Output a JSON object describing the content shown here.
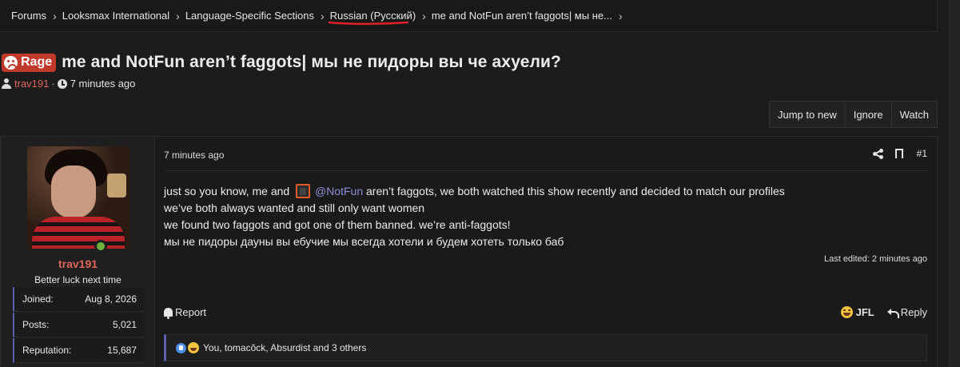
{
  "breadcrumb": [
    {
      "label": "Forums"
    },
    {
      "label": "Looksmax International"
    },
    {
      "label": "Language-Specific Sections"
    },
    {
      "label": "Russian (Русский)"
    },
    {
      "label": "me and NotFun aren’t faggots| мы не..."
    }
  ],
  "thread": {
    "prefix": "Rage",
    "title": "me and NotFun aren’t faggots| мы не пидоры вы че ахуели?",
    "author": "trav191",
    "separator": "·",
    "time": "7 minutes ago"
  },
  "thread_actions": {
    "jump_label": "Jump to new",
    "ignore_label": "Ignore",
    "watch_label": "Watch"
  },
  "post": {
    "time": "7 minutes ago",
    "number": "#1",
    "user": {
      "name": "trav191",
      "title": "Better luck next time",
      "stats": [
        {
          "key": "Joined:",
          "value": "Aug 8, 2026"
        },
        {
          "key": "Posts:",
          "value": "5,021"
        },
        {
          "key": "Reputation:",
          "value": "15,687"
        }
      ]
    },
    "body": {
      "line1_before": "just so you know, me and",
      "mention": "@NotFun",
      "line1_after": " aren’t faggots, we both watched this show recently and decided to match our profiles",
      "line2": "we’ve both always wanted and still only want women",
      "line3": "we found two faggots and got one of them banned. we’re anti-faggots!",
      "line4": "мы не пидоры дауны вы ебучие мы всегда хотели и будем хотеть только баб"
    },
    "last_edited": "Last edited: 2 minutes ago",
    "report_label": "Report",
    "reaction_label": "JFL",
    "reply_label": "Reply",
    "reactions_summary": "You, tomacŏck, Absurdist and 3 others"
  },
  "colors": {
    "background": "#1c1c1c",
    "username": "#e0665a",
    "mention": "#8c8fd8",
    "rage_badge": "#c0392b",
    "annotation_underline": "#e0202a",
    "accent_border": "#5a5fb0"
  }
}
